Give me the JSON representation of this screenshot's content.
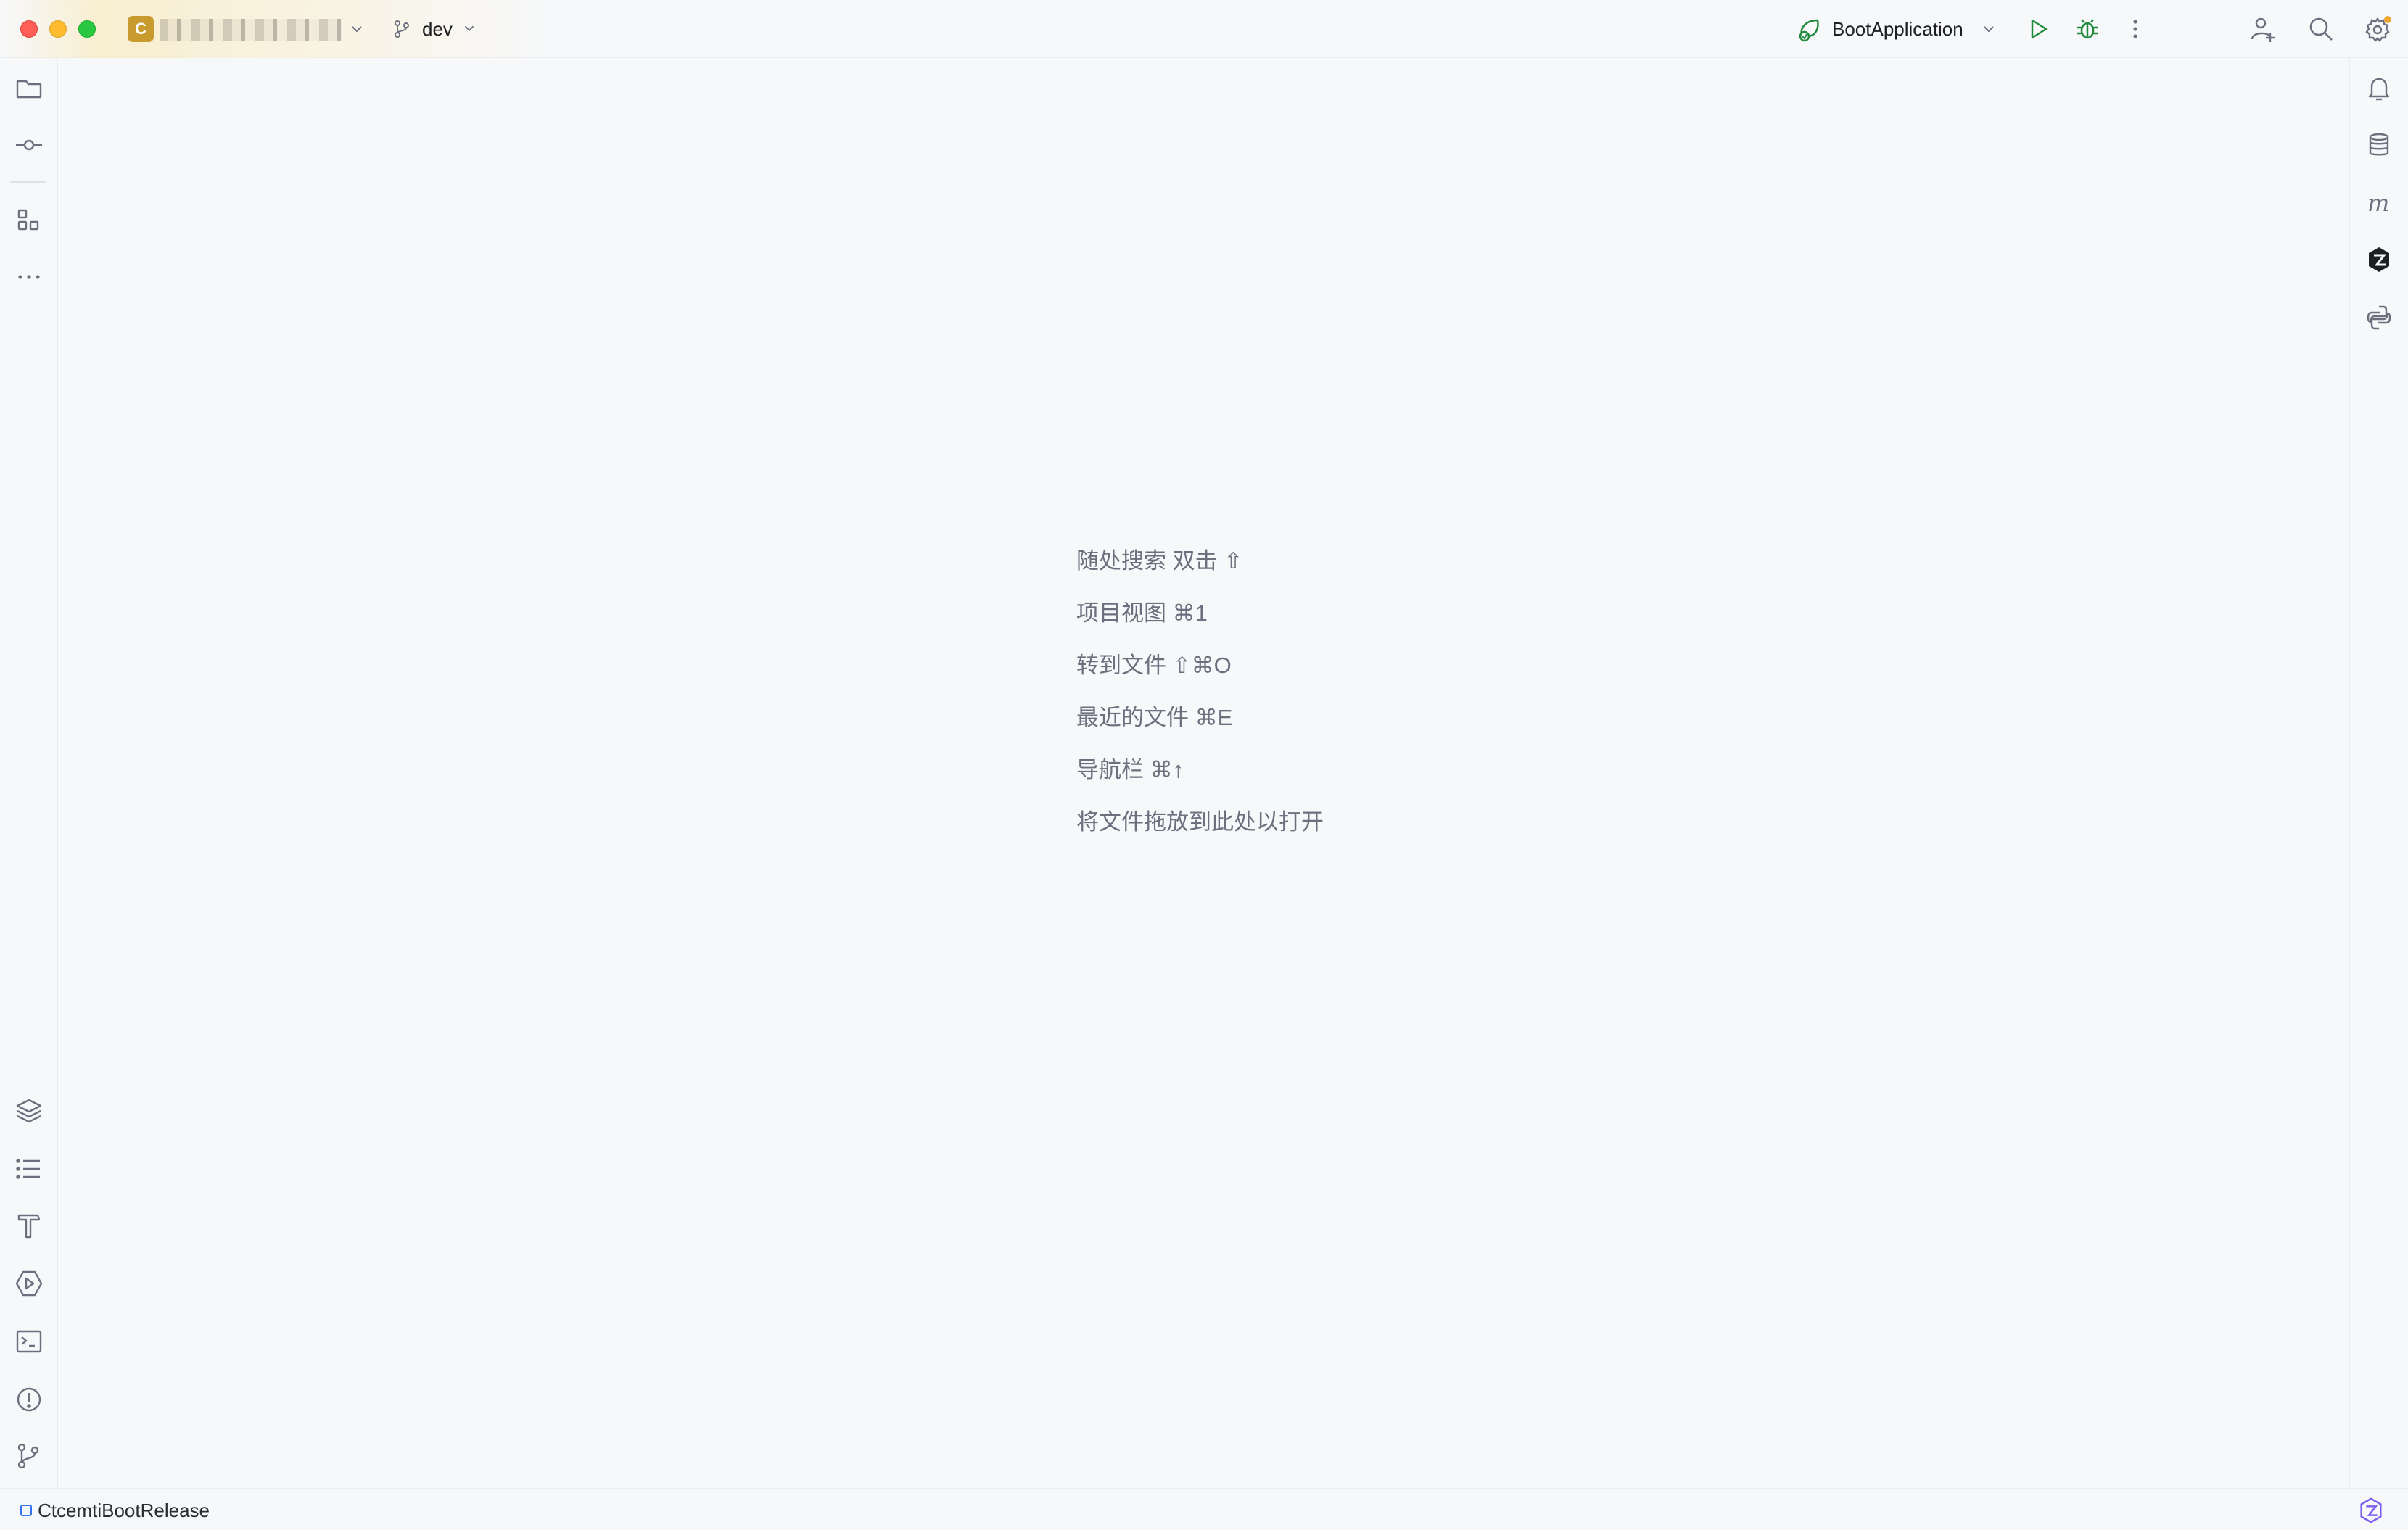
{
  "titlebar": {
    "project_badge": "C",
    "branch": "dev",
    "run_config": "BootApplication"
  },
  "editor": {
    "hints": [
      "随处搜索 双击 ⇧",
      "项目视图 ⌘1",
      "转到文件 ⇧⌘O",
      "最近的文件 ⌘E",
      "导航栏 ⌘↑",
      "将文件拖放到此处以打开"
    ]
  },
  "statusbar": {
    "project_label": "CtcemtiBootRelease"
  },
  "colors": {
    "background": "#f7f8fa",
    "run_green": "#208a3c",
    "accent_blue": "#3574f0",
    "notification_dot": "#f0a732",
    "icon_gray": "#6c707e"
  }
}
